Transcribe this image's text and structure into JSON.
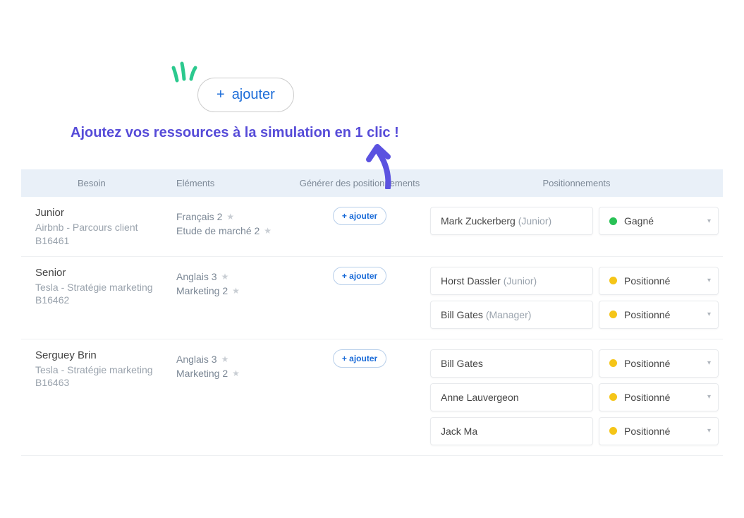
{
  "hero": {
    "add_label": "ajouter",
    "tagline": "Ajoutez vos ressources à la simulation en 1 clic !"
  },
  "table": {
    "headers": {
      "besoin": "Besoin",
      "elements": "Eléments",
      "generer": "Générer des positionnements",
      "positionnements": "Positionnements"
    },
    "add_button_label": "+ ajouter",
    "rows": [
      {
        "title": "Junior",
        "subtitle": "Airbnb - Parcours client",
        "code": "B16461",
        "elements": [
          {
            "name": "Français",
            "rating": "2"
          },
          {
            "name": "Etude de marché",
            "rating": "2"
          }
        ],
        "positions": [
          {
            "name": "Mark Zuckerberg",
            "role": "Junior",
            "status": "Gagné",
            "color": "green"
          }
        ]
      },
      {
        "title": "Senior",
        "subtitle": "Tesla - Stratégie marketing",
        "code": "B16462",
        "elements": [
          {
            "name": "Anglais",
            "rating": "3"
          },
          {
            "name": "Marketing",
            "rating": "2"
          }
        ],
        "positions": [
          {
            "name": "Horst Dassler",
            "role": "Junior",
            "status": "Positionné",
            "color": "yellow"
          },
          {
            "name": "Bill Gates",
            "role": "Manager",
            "status": "Positionné",
            "color": "yellow"
          }
        ]
      },
      {
        "title": "Serguey Brin",
        "subtitle": "Tesla - Stratégie marketing",
        "code": "B16463",
        "elements": [
          {
            "name": "Anglais",
            "rating": "3"
          },
          {
            "name": "Marketing",
            "rating": "2"
          }
        ],
        "positions": [
          {
            "name": "Bill Gates",
            "role": "",
            "status": "Positionné",
            "color": "yellow"
          },
          {
            "name": "Anne Lauvergeon",
            "role": "",
            "status": "Positionné",
            "color": "yellow"
          },
          {
            "name": "Jack Ma",
            "role": "",
            "status": "Positionné",
            "color": "yellow"
          }
        ]
      }
    ]
  }
}
